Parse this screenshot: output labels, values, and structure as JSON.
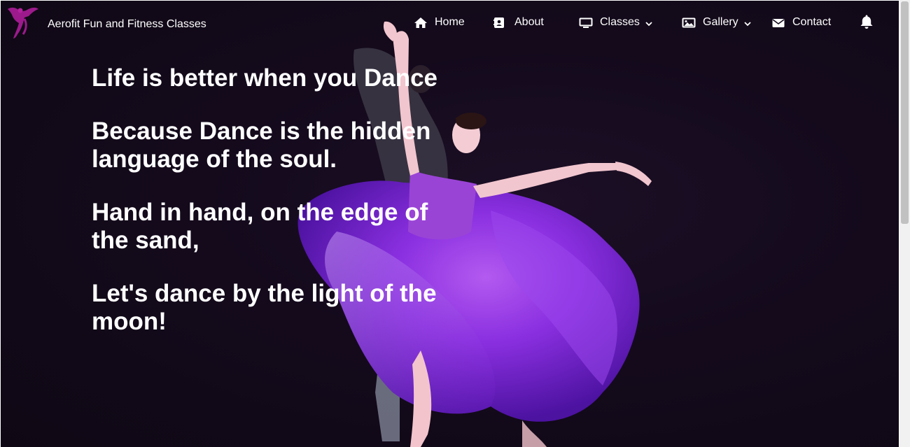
{
  "brand": {
    "name": "Aerofit Fun and Fitness Classes",
    "logo_icon": "dancer-logo-icon",
    "logo_color": "#9c1a8c"
  },
  "nav": {
    "items": [
      {
        "label": "Home",
        "icon": "home-icon"
      },
      {
        "label": "About",
        "icon": "contact-card-icon"
      },
      {
        "label": "Classes",
        "icon": "monitor-icon",
        "has_dropdown": true
      },
      {
        "label": "Gallery",
        "icon": "image-icon",
        "has_dropdown": true
      },
      {
        "label": "Contact",
        "icon": "envelope-icon"
      }
    ],
    "notification_icon": "bell-icon"
  },
  "hero": {
    "quotes": [
      "Life is better when you Dance",
      "Because Dance is the hidden language of the soul.",
      "Hand in hand, on the edge of the sand,",
      "Let's dance by the light of the moon!"
    ],
    "image_subject": "ballet dancer in purple dress",
    "dress_color": "#7b1fd0",
    "background_color": "#140a1c"
  }
}
